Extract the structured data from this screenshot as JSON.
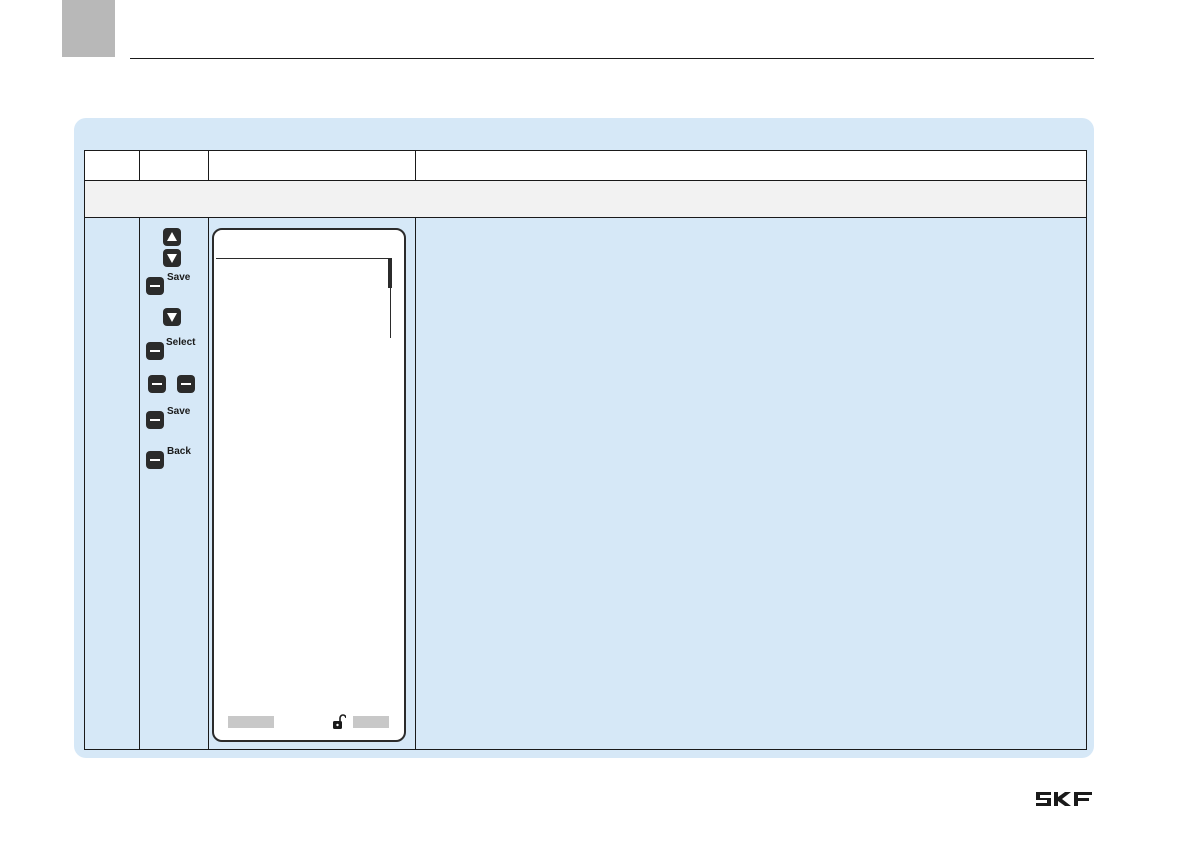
{
  "document": {
    "table_headers": [
      "",
      "",
      "",
      ""
    ],
    "section_title": "",
    "description_text": ""
  },
  "keys": [
    {
      "icon": "arrow-up-icon"
    },
    {
      "icon": "arrow-down-icon"
    },
    {
      "icon": "soft-key-icon",
      "label": "Save"
    },
    {
      "icon": "arrow-down-icon"
    },
    {
      "icon": "soft-key-icon",
      "label": "Select"
    },
    {
      "icon": "soft-key-icon"
    },
    {
      "icon": "soft-key-icon"
    },
    {
      "icon": "soft-key-icon",
      "label": "Save"
    },
    {
      "icon": "soft-key-icon",
      "label": "Back"
    }
  ],
  "screen": {
    "lock_icon": "unlock-icon"
  },
  "brand": {
    "logo_text": "SKF"
  },
  "colors": {
    "panel": "#d6e8f7",
    "section_row": "#f2f2f2",
    "corner_tab": "#b8b8b8",
    "key": "#2b2b2b",
    "logo": "#1a1a1a"
  }
}
